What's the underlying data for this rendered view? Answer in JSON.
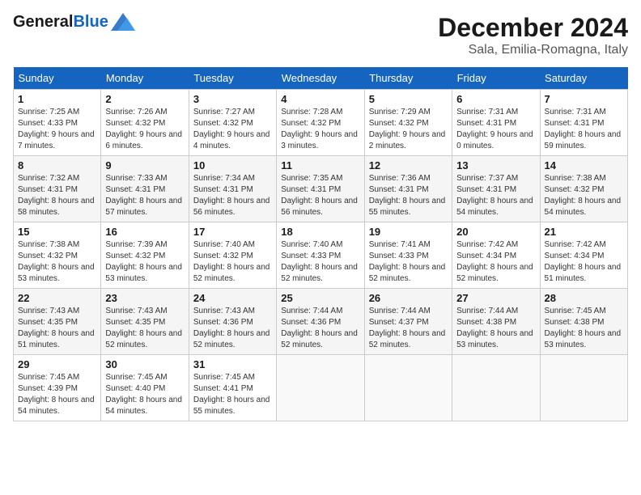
{
  "header": {
    "logo_line1": "General",
    "logo_line2": "Blue",
    "month": "December 2024",
    "location": "Sala, Emilia-Romagna, Italy"
  },
  "days_of_week": [
    "Sunday",
    "Monday",
    "Tuesday",
    "Wednesday",
    "Thursday",
    "Friday",
    "Saturday"
  ],
  "weeks": [
    [
      {
        "day": "1",
        "sunrise": "7:25 AM",
        "sunset": "4:33 PM",
        "daylight": "9 hours and 7 minutes."
      },
      {
        "day": "2",
        "sunrise": "7:26 AM",
        "sunset": "4:32 PM",
        "daylight": "9 hours and 6 minutes."
      },
      {
        "day": "3",
        "sunrise": "7:27 AM",
        "sunset": "4:32 PM",
        "daylight": "9 hours and 4 minutes."
      },
      {
        "day": "4",
        "sunrise": "7:28 AM",
        "sunset": "4:32 PM",
        "daylight": "9 hours and 3 minutes."
      },
      {
        "day": "5",
        "sunrise": "7:29 AM",
        "sunset": "4:32 PM",
        "daylight": "9 hours and 2 minutes."
      },
      {
        "day": "6",
        "sunrise": "7:31 AM",
        "sunset": "4:31 PM",
        "daylight": "9 hours and 0 minutes."
      },
      {
        "day": "7",
        "sunrise": "7:31 AM",
        "sunset": "4:31 PM",
        "daylight": "8 hours and 59 minutes."
      }
    ],
    [
      {
        "day": "8",
        "sunrise": "7:32 AM",
        "sunset": "4:31 PM",
        "daylight": "8 hours and 58 minutes."
      },
      {
        "day": "9",
        "sunrise": "7:33 AM",
        "sunset": "4:31 PM",
        "daylight": "8 hours and 57 minutes."
      },
      {
        "day": "10",
        "sunrise": "7:34 AM",
        "sunset": "4:31 PM",
        "daylight": "8 hours and 56 minutes."
      },
      {
        "day": "11",
        "sunrise": "7:35 AM",
        "sunset": "4:31 PM",
        "daylight": "8 hours and 56 minutes."
      },
      {
        "day": "12",
        "sunrise": "7:36 AM",
        "sunset": "4:31 PM",
        "daylight": "8 hours and 55 minutes."
      },
      {
        "day": "13",
        "sunrise": "7:37 AM",
        "sunset": "4:31 PM",
        "daylight": "8 hours and 54 minutes."
      },
      {
        "day": "14",
        "sunrise": "7:38 AM",
        "sunset": "4:32 PM",
        "daylight": "8 hours and 54 minutes."
      }
    ],
    [
      {
        "day": "15",
        "sunrise": "7:38 AM",
        "sunset": "4:32 PM",
        "daylight": "8 hours and 53 minutes."
      },
      {
        "day": "16",
        "sunrise": "7:39 AM",
        "sunset": "4:32 PM",
        "daylight": "8 hours and 53 minutes."
      },
      {
        "day": "17",
        "sunrise": "7:40 AM",
        "sunset": "4:32 PM",
        "daylight": "8 hours and 52 minutes."
      },
      {
        "day": "18",
        "sunrise": "7:40 AM",
        "sunset": "4:33 PM",
        "daylight": "8 hours and 52 minutes."
      },
      {
        "day": "19",
        "sunrise": "7:41 AM",
        "sunset": "4:33 PM",
        "daylight": "8 hours and 52 minutes."
      },
      {
        "day": "20",
        "sunrise": "7:42 AM",
        "sunset": "4:34 PM",
        "daylight": "8 hours and 52 minutes."
      },
      {
        "day": "21",
        "sunrise": "7:42 AM",
        "sunset": "4:34 PM",
        "daylight": "8 hours and 51 minutes."
      }
    ],
    [
      {
        "day": "22",
        "sunrise": "7:43 AM",
        "sunset": "4:35 PM",
        "daylight": "8 hours and 51 minutes."
      },
      {
        "day": "23",
        "sunrise": "7:43 AM",
        "sunset": "4:35 PM",
        "daylight": "8 hours and 52 minutes."
      },
      {
        "day": "24",
        "sunrise": "7:43 AM",
        "sunset": "4:36 PM",
        "daylight": "8 hours and 52 minutes."
      },
      {
        "day": "25",
        "sunrise": "7:44 AM",
        "sunset": "4:36 PM",
        "daylight": "8 hours and 52 minutes."
      },
      {
        "day": "26",
        "sunrise": "7:44 AM",
        "sunset": "4:37 PM",
        "daylight": "8 hours and 52 minutes."
      },
      {
        "day": "27",
        "sunrise": "7:44 AM",
        "sunset": "4:38 PM",
        "daylight": "8 hours and 53 minutes."
      },
      {
        "day": "28",
        "sunrise": "7:45 AM",
        "sunset": "4:38 PM",
        "daylight": "8 hours and 53 minutes."
      }
    ],
    [
      {
        "day": "29",
        "sunrise": "7:45 AM",
        "sunset": "4:39 PM",
        "daylight": "8 hours and 54 minutes."
      },
      {
        "day": "30",
        "sunrise": "7:45 AM",
        "sunset": "4:40 PM",
        "daylight": "8 hours and 54 minutes."
      },
      {
        "day": "31",
        "sunrise": "7:45 AM",
        "sunset": "4:41 PM",
        "daylight": "8 hours and 55 minutes."
      },
      null,
      null,
      null,
      null
    ]
  ],
  "labels": {
    "sunrise_label": "Sunrise:",
    "sunset_label": "Sunset:",
    "daylight_label": "Daylight:"
  }
}
